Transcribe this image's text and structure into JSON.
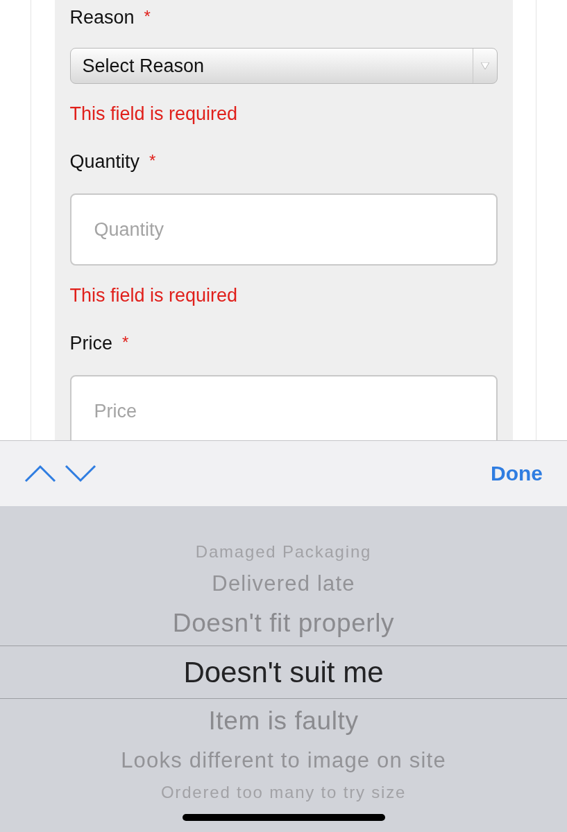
{
  "form": {
    "fields": [
      {
        "kind": "select",
        "label": "Reason",
        "required_mark": "*",
        "value": "Select Reason",
        "error": "This field is required"
      },
      {
        "kind": "input",
        "label": "Quantity",
        "required_mark": "*",
        "placeholder": "Quantity",
        "error": "This field is required"
      },
      {
        "kind": "input",
        "label": "Price",
        "required_mark": "*",
        "placeholder": "Price"
      }
    ]
  },
  "toolbar": {
    "done": "Done"
  },
  "picker": {
    "options": [
      {
        "label": "Damaged Packaging",
        "selected": false
      },
      {
        "label": "Delivered late",
        "selected": false
      },
      {
        "label": "Doesn't fit properly",
        "selected": false
      },
      {
        "label": "Doesn't suit me",
        "selected": true
      },
      {
        "label": "Item is faulty",
        "selected": false
      },
      {
        "label": "Looks different to image on site",
        "selected": false
      },
      {
        "label": "Ordered too many to try size",
        "selected": false
      }
    ]
  }
}
